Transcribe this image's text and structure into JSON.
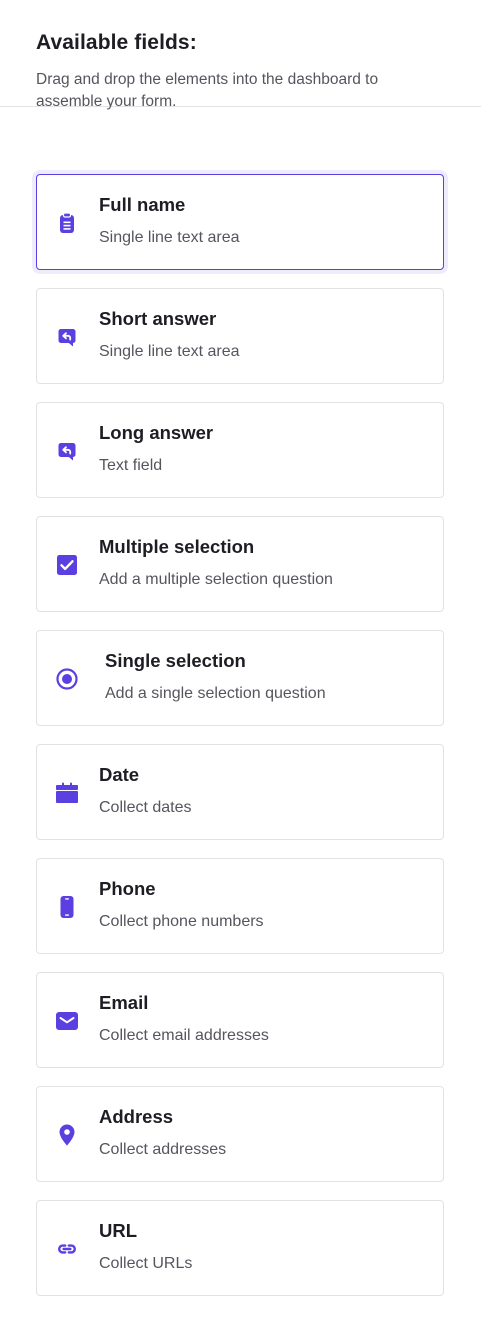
{
  "panel": {
    "title": "Available fields:",
    "subtitle": "Drag and drop the elements into the dashboard to assemble your form."
  },
  "accent_color": "#5b3fe0",
  "fields": [
    {
      "name": "Full name",
      "description": "Single line text area",
      "icon": "clipboard-icon",
      "selected": true
    },
    {
      "name": "Short answer",
      "description": "Single line text area",
      "icon": "reply-bubble-icon"
    },
    {
      "name": "Long answer",
      "description": "Text field",
      "icon": "reply-bubble-icon"
    },
    {
      "name": "Multiple selection",
      "description": "Add a multiple selection question",
      "icon": "checkbox-icon"
    },
    {
      "name": "Single selection",
      "description": "Add a single selection question",
      "icon": "radio-icon"
    },
    {
      "name": "Date",
      "description": "Collect dates",
      "icon": "calendar-icon"
    },
    {
      "name": "Phone",
      "description": "Collect phone numbers",
      "icon": "phone-icon"
    },
    {
      "name": "Email",
      "description": "Collect email addresses",
      "icon": "envelope-icon"
    },
    {
      "name": "Address",
      "description": "Collect addresses",
      "icon": "map-pin-icon"
    },
    {
      "name": "URL",
      "description": "Collect URLs",
      "icon": "link-icon"
    }
  ]
}
